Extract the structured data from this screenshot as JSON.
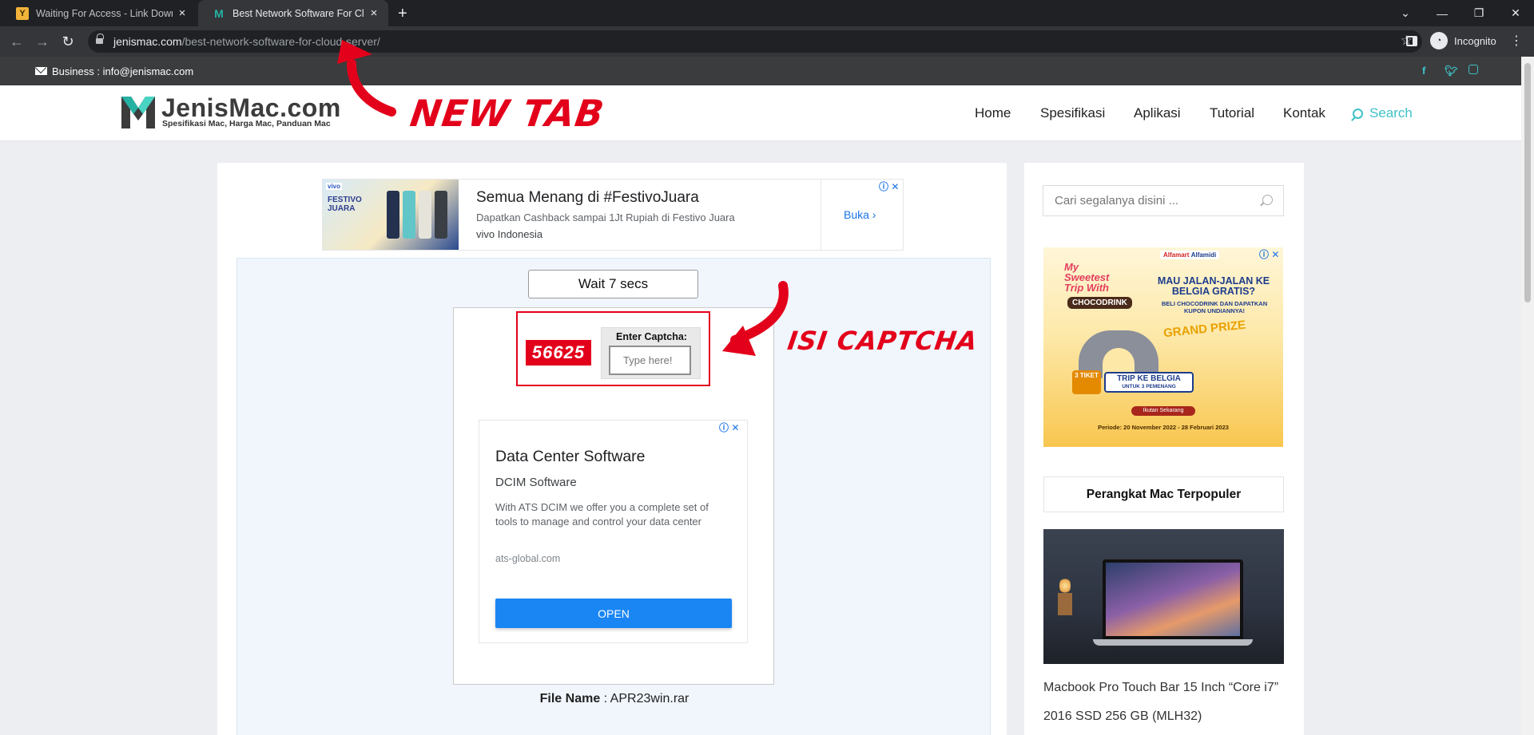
{
  "browser": {
    "tabs": [
      {
        "title": "Waiting For Access - Link Downlo",
        "favicon": "Y",
        "active": false
      },
      {
        "title": "Best Network Software For Cloud",
        "favicon": "M",
        "active": true
      }
    ],
    "new_tab_symbol": "+",
    "url_host": "jenismac.com",
    "url_path": "/best-network-software-for-cloud-server/",
    "profile_label": "Incognito"
  },
  "topbar": {
    "email": "Business : info@jenismac.com",
    "social_icons": [
      "facebook-icon",
      "twitter-icon",
      "instagram-icon"
    ]
  },
  "site": {
    "logo_name": "JenisMac.com",
    "logo_tagline": "Spesifikasi Mac, Harga Mac, Panduan Mac",
    "nav": [
      "Home",
      "Spesifikasi",
      "Aplikasi",
      "Tutorial",
      "Kontak"
    ],
    "search_label": "Search",
    "accent_color": "#3fc1c9"
  },
  "ad_banner": {
    "headline": "Semua Menang di #FestivoJuara",
    "description": "Dapatkan Cashback sampai 1Jt Rupiah di Festivo Juara",
    "advertiser": "vivo Indonesia",
    "cta": "Buka",
    "image_brand": "vivo",
    "image_promo": "FESTIVO JUARA"
  },
  "download": {
    "wait_label": "Wait 7 secs",
    "captcha_code": "56625",
    "captcha_label": "Enter Captcha:",
    "captcha_placeholder": "Type here!",
    "file_name_label": "File Name",
    "file_name": "APR23win.rar"
  },
  "ad_box": {
    "headline": "Data Center Software",
    "subhead": "DCIM Software",
    "description": "With ATS DCIM we offer you a complete set of tools to manage and control your data center",
    "url": "ats-global.com",
    "cta": "OPEN"
  },
  "annotations": {
    "new_tab": "NEW TAB",
    "captcha": "ISI CAPTCHA",
    "color": "#e3001b"
  },
  "sidebar": {
    "search_placeholder": "Cari segalanya disini ...",
    "ad": {
      "logos_a": "Alfamart",
      "logos_b": "Alfamidi",
      "title": "My Sweetest Trip With",
      "product": "CHOCODRINK",
      "question": "MAU JALAN-JALAN KE BELGIA GRATIS?",
      "sub": "BELI CHOCODRINK DAN DAPATKAN KUPON UNDIANNYA!",
      "prize": "GRAND PRIZE",
      "tiket": "3 TIKET",
      "trip": "TRIP KE BELGIA",
      "trip_sub": "UNTUK 3 PEMENANG",
      "cta": "Ikutan Sekarang",
      "period": "Periode: 20 November 2022 - 28 Februari 2023"
    },
    "widget_title": "Perangkat Mac Terpopuler",
    "post_title": "Macbook Pro Touch Bar 15 Inch “Core i7” 2016 SSD 256 GB (MLH32)"
  }
}
